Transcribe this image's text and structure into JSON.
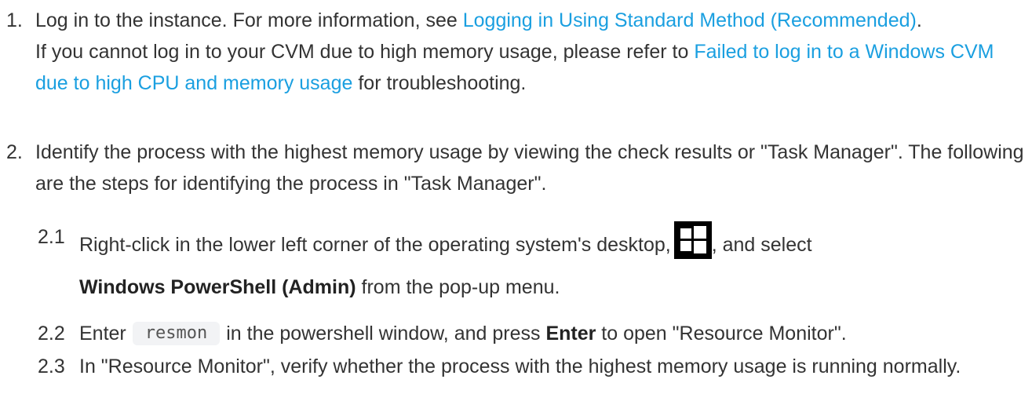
{
  "steps": [
    {
      "number": "1.",
      "text_before": "Log in to the instance. For more information, see ",
      "link": "Logging in Using Standard Method (Recommended)",
      "text_after": ".",
      "note_before": "If you cannot log in to your CVM due to high memory usage, please refer to ",
      "note_link": "Failed to log in to a Windows CVM due to high CPU and memory usage",
      "note_after": " for troubleshooting."
    },
    {
      "number": "2.",
      "text": "Identify the process with the highest memory usage by viewing the check results or \"Task Manager\". The following are the steps for identifying the process in \"Task Manager\"."
    }
  ],
  "substeps": [
    {
      "number": "2.1",
      "text_before": "Right-click in the lower left corner of the operating system's desktop,",
      "icon": "windows-logo-icon",
      "text_after": ", and select",
      "bold": "Windows PowerShell (Admin)",
      "text_end": " from the pop-up menu."
    },
    {
      "number": "2.2",
      "text_before": "Enter",
      "code": "resmon",
      "text_middle": "in the powershell window, and press ",
      "bold": "Enter",
      "text_after": " to open \"Resource Monitor\"."
    },
    {
      "number": "2.3",
      "text": "In \"Resource Monitor\", verify whether the process with the highest memory usage is running normally."
    }
  ],
  "colors": {
    "text": "#333333",
    "link": "#1a9fe0",
    "code_bg": "#f2f3f5",
    "icon_bg": "#000000"
  }
}
